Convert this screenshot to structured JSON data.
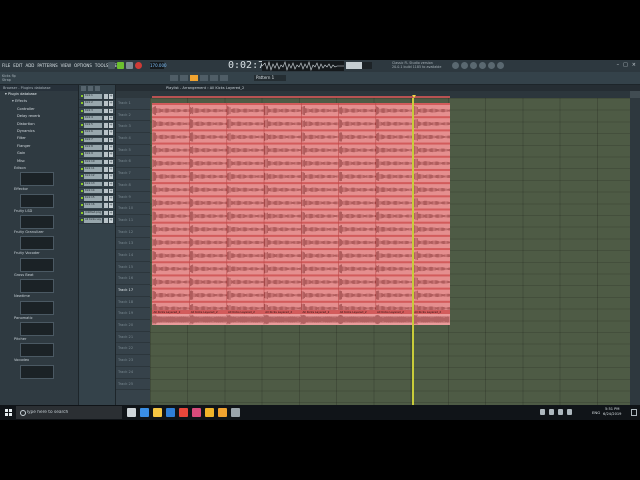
{
  "menu": [
    "FILE",
    "EDIT",
    "ADD",
    "PATTERNS",
    "VIEW",
    "OPTIONS",
    "TOOLS",
    "HELP"
  ],
  "transport": {
    "tempo": "170.000",
    "time": "0:02:76",
    "pattern": "Pattern 1"
  },
  "hint_right": [
    "Classic FL Studio version",
    "20.0.1 build 1185 to available"
  ],
  "hint_left": [
    "Kicks flp",
    "Strap"
  ],
  "browser": {
    "header": "Browser - Plugins database",
    "database": "Plugin database",
    "group": "Effects",
    "categories": [
      "Controller",
      "Delay reverb",
      "Distortion",
      "Dynamics",
      "Filter",
      "Flanger",
      "Gain",
      "Misc"
    ],
    "plugins": [
      "Edison",
      "Effector",
      "Fruity LSD",
      "Fruity Granulizer",
      "Fruity Vocoder",
      "Gross Beat",
      "Newtime",
      "Panomatic",
      "Pitcher",
      "Vocodex"
    ],
    "plugin_indices_with_thumbs": [
      0,
      1,
      2,
      3,
      4,
      5,
      6,
      7,
      8,
      9
    ]
  },
  "channels": [
    "Kick 1",
    "Kick 2",
    "Kick 3",
    "Kick 4",
    "Kick 5",
    "Kick 6",
    "Kick 7",
    "Kick 8",
    "Kick 9",
    "Kick 10",
    "Kick 11",
    "Kick 12",
    "Kick 13",
    "Kick 14",
    "Kick 15",
    "Kick 16",
    "Untitled.png",
    "All Kicks Lay"
  ],
  "playlist": {
    "title": "Playlist - Arrangement › All Kicks Layered_2",
    "tracks": [
      "Track 1",
      "Track 2",
      "Track 3",
      "Track 4",
      "Track 5",
      "Track 6",
      "Track 7",
      "Track 8",
      "Track 9",
      "Track 10",
      "Track 11",
      "Track 12",
      "Track 13",
      "Track 14",
      "Track 15",
      "Track 16",
      "Track 17",
      "Track 18",
      "Track 19",
      "Track 20",
      "Track 21",
      "Track 22",
      "Track 23",
      "Track 24",
      "Track 25"
    ],
    "active_track_index": 16,
    "clip_label": "All Kicks Layered_2",
    "clip_segments": 8,
    "stacked_clip_rows": 16,
    "grid_color": "#4e5b45",
    "clip_color": "#e58f8f"
  },
  "taskbar": {
    "search_placeholder": "Type here to search",
    "language": "ENG",
    "time": "5:51 PM",
    "date": "6/24/2019",
    "app_icons": [
      "task-view-icon",
      "edge-icon",
      "file-explorer-icon",
      "store-icon",
      "chrome-icon",
      "app-icon",
      "folder-icon",
      "fl-studio-icon",
      "media-icon"
    ]
  },
  "colors": {
    "accent": "#f0a330",
    "play": "#6bbf2e",
    "record": "#cf3b36",
    "playhead": "#c8cc3a"
  }
}
